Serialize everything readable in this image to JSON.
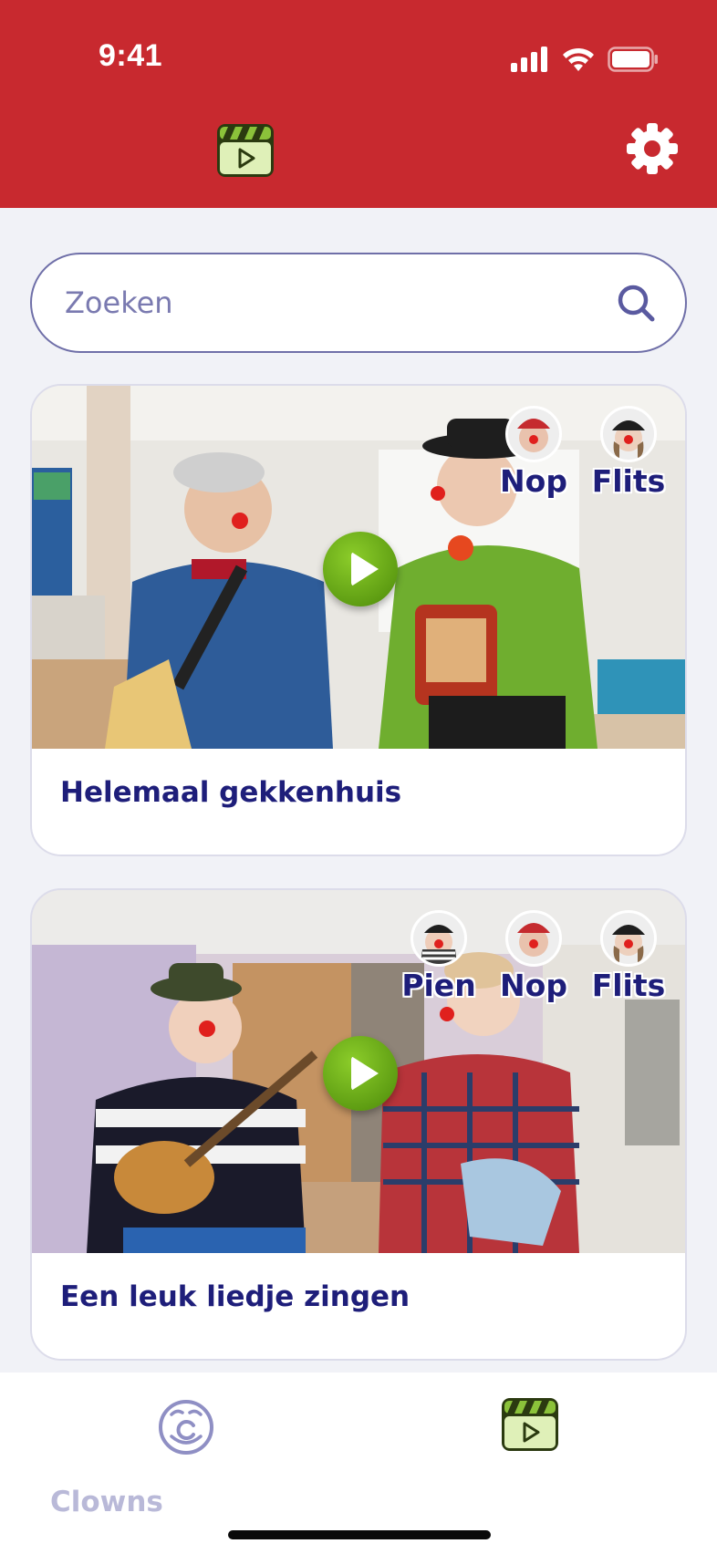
{
  "status_bar": {
    "time": "9:41"
  },
  "search": {
    "placeholder": "Zoeken"
  },
  "videos": [
    {
      "title": "Helemaal gekkenhuis",
      "clowns": [
        "Nop",
        "Flits"
      ]
    },
    {
      "title": "Een leuk liedje zingen",
      "clowns": [
        "Pien",
        "Nop",
        "Flits"
      ]
    }
  ],
  "tabbar": {
    "clowns_label": "Clowns"
  },
  "colors": {
    "header_red": "#c8292f",
    "brand_navy": "#1e1e7a",
    "play_green": "#6aab16",
    "video_icon_green": "#dff0b8"
  },
  "icons": {
    "header_logo": "video-clapper-icon",
    "settings": "gear-icon",
    "search": "search-icon",
    "play": "play-icon",
    "tab_clowns": "clown-face-icon",
    "tab_videos": "video-clapper-icon"
  }
}
